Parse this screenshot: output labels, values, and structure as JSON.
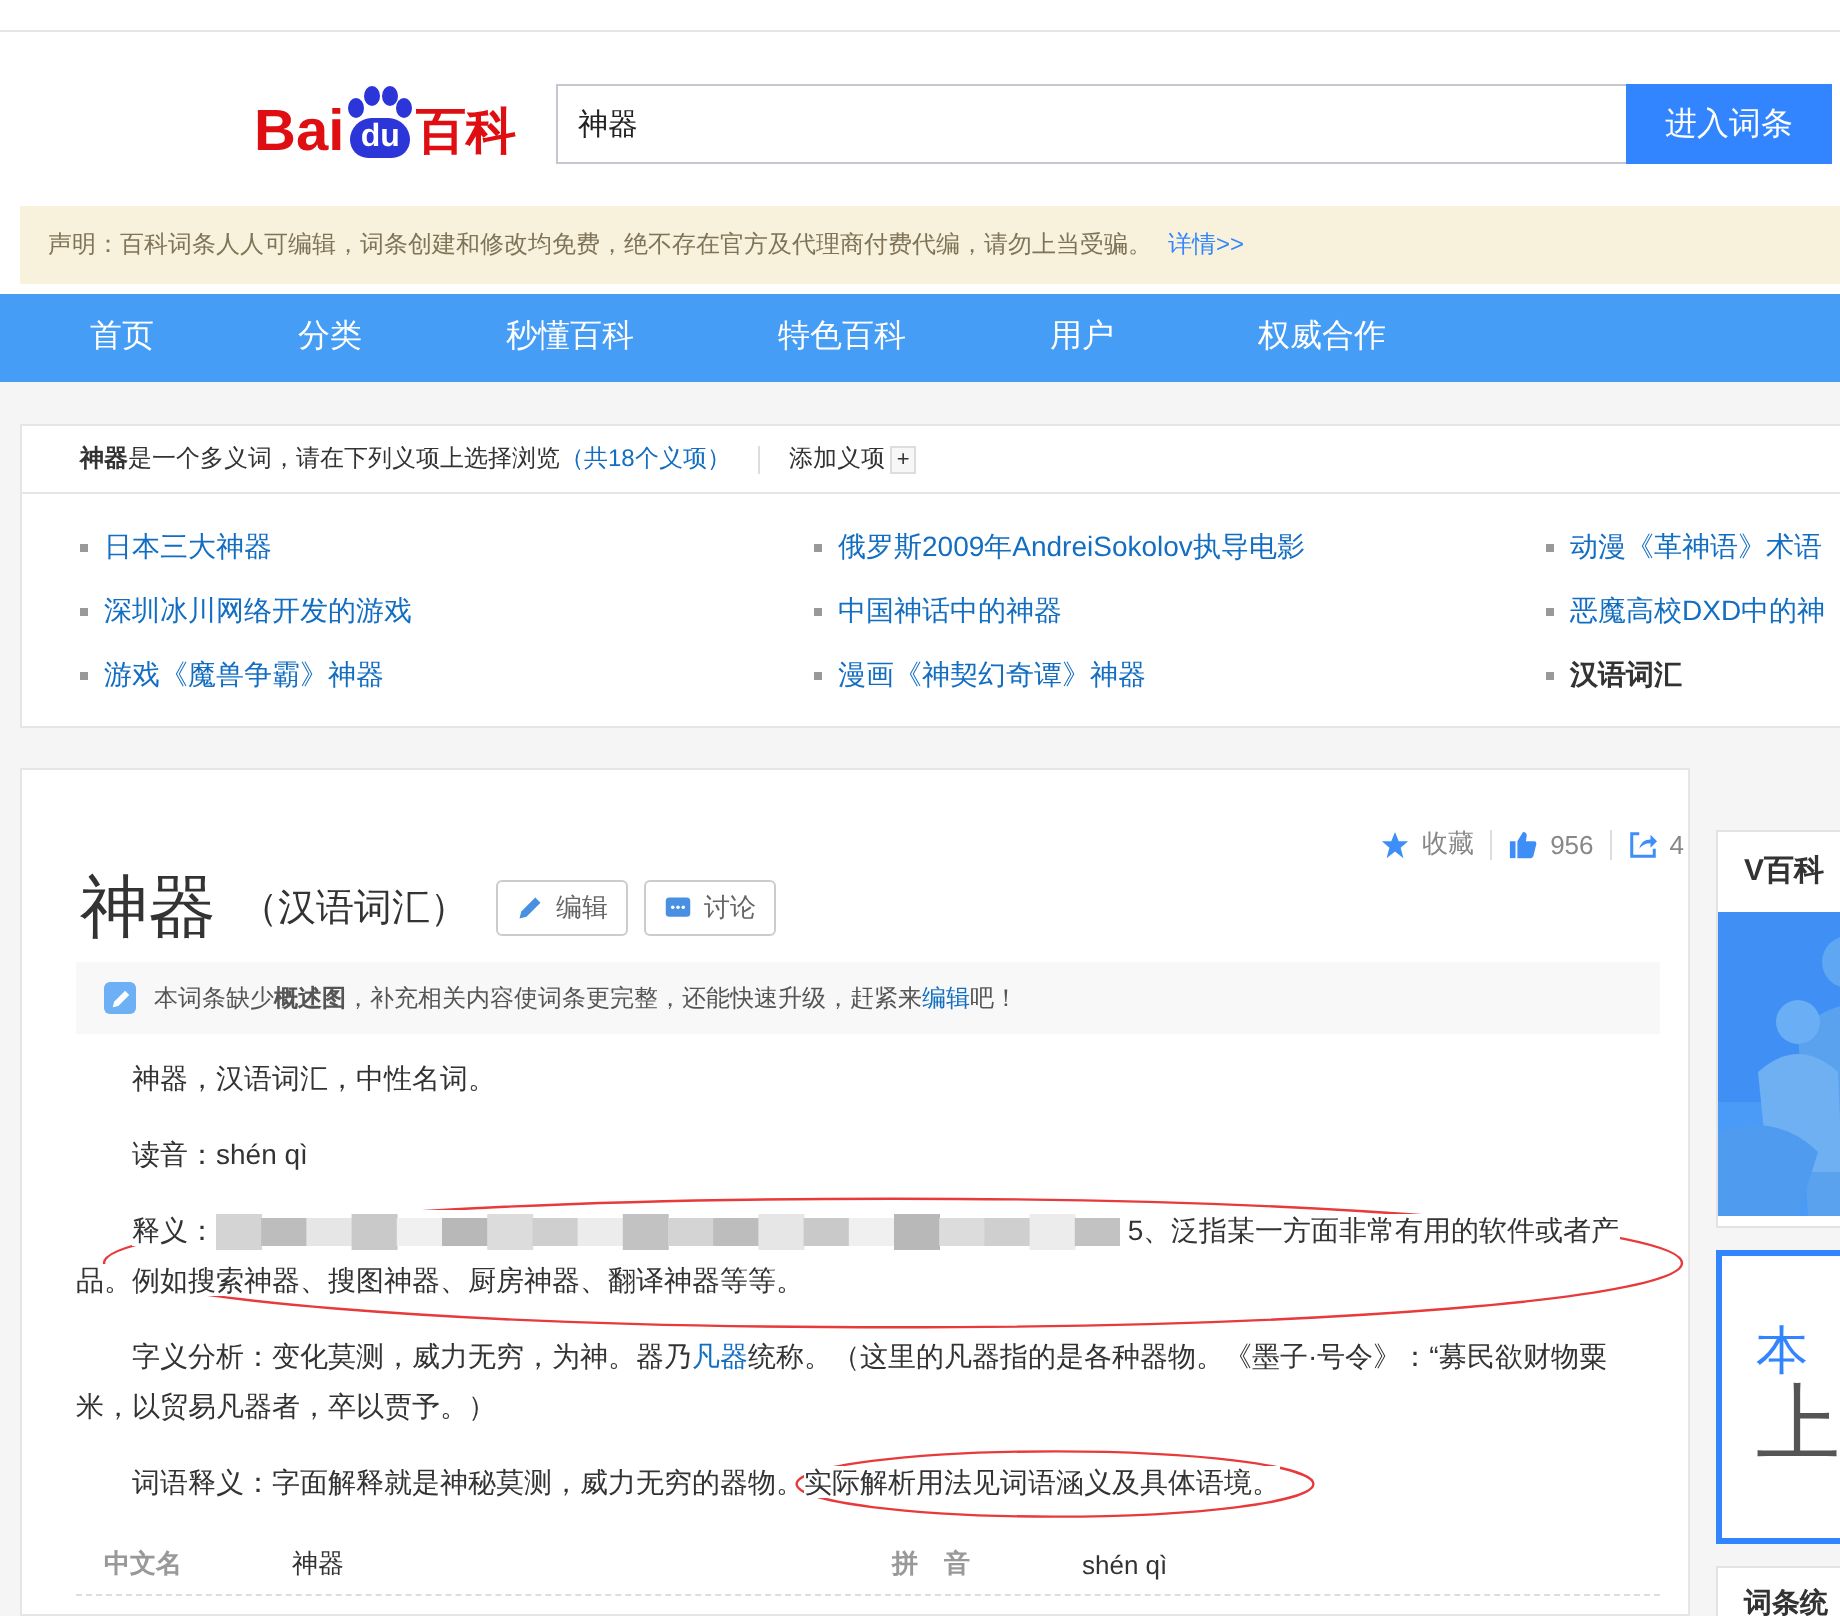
{
  "header": {
    "logo": {
      "left": "Bai",
      "badge": "du",
      "right": "百科"
    },
    "search": {
      "value": "神器",
      "button": "进入词条"
    }
  },
  "notice": {
    "text": "声明：百科词条人人可编辑，词条创建和修改均免费，绝不存在官方及代理商付费代编，请勿上当受骗。",
    "link": "详情>>"
  },
  "nav": [
    {
      "label": "首页"
    },
    {
      "label": "分类"
    },
    {
      "label": "秒懂百科"
    },
    {
      "label": "特色百科"
    },
    {
      "label": "用户"
    },
    {
      "label": "权威合作"
    }
  ],
  "polysemant": {
    "term": "神器",
    "text": "是一个多义词，请在下列义项上选择浏览",
    "count": "（共18个义项）",
    "add": "添加义项",
    "add_icon": "+",
    "items": [
      {
        "label": "日本三大神器",
        "selected": false
      },
      {
        "label": "俄罗斯2009年AndreiSokolov执导电影",
        "selected": false
      },
      {
        "label": "动漫《革神语》术语",
        "selected": false
      },
      {
        "label": "深圳冰川网络开发的游戏",
        "selected": false
      },
      {
        "label": "中国神话中的神器",
        "selected": false
      },
      {
        "label": "恶魔高校DXD中的神",
        "selected": false
      },
      {
        "label": "游戏《魔兽争霸》神器",
        "selected": false
      },
      {
        "label": "漫画《神契幻奇谭》神器",
        "selected": false
      },
      {
        "label": "汉语词汇",
        "selected": true
      }
    ]
  },
  "article": {
    "actions": [
      {
        "kind": "favorite",
        "label": "收藏"
      },
      {
        "kind": "like",
        "label": "956"
      },
      {
        "kind": "share",
        "label": "4"
      }
    ],
    "title": "神器",
    "subtitle": "（汉语词汇）",
    "buttons": [
      {
        "kind": "edit",
        "label": "编辑"
      },
      {
        "kind": "discuss",
        "label": "讨论"
      }
    ],
    "tip": {
      "before": "本词条缺少**概述图**，补充相关内容使词条更完整，还能快速升级，赶紧来",
      "link": "编辑",
      "after": "吧！"
    },
    "paragraphs": [
      {
        "kind": "plain",
        "text": "神器，汉语词汇，中性名词。",
        "circled": false
      },
      {
        "kind": "plain",
        "text": "读音：shén qì",
        "circled": false
      },
      {
        "kind": "blurred",
        "before": "释义：",
        "after": "5、泛指某一方面非常有用的软件或者产品。例如搜索神器、搜图神器、厨房神器、翻译神器等等。",
        "circled": true
      },
      {
        "kind": "link",
        "before": "字义分析：变化莫测，威力无穷，为神。器乃",
        "link": "凡器",
        "after": "统称。（这里的凡器指的是各种器物。《墨子·号令》：“募民欲财物粟米，以贸易凡器者，卒以贾予。）",
        "circled": false
      },
      {
        "kind": "plain",
        "text": "词语释义：字面解释就是神秘莫测，威力无穷的器物。",
        "tail": "实际解析用法见词语涵义及具体语境。",
        "circled": true
      }
    ],
    "info": [
      {
        "label": "中文名",
        "value": "神器"
      },
      {
        "label": "拼　音",
        "value": "shén qì"
      }
    ]
  },
  "sidebar": {
    "vbaike": {
      "title": "V百科",
      "kind": "picture"
    },
    "promo": {
      "line1": "本",
      "line2": "上"
    },
    "stats": {
      "title": "词条统"
    }
  }
}
